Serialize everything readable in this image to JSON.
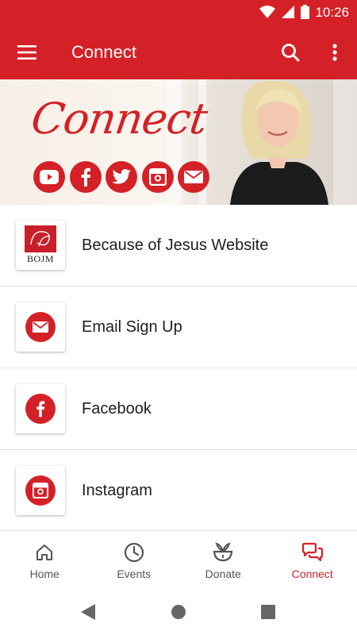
{
  "status_bar": {
    "time": "10:26"
  },
  "app_bar": {
    "title": "Connect"
  },
  "banner": {
    "heading": "Connect"
  },
  "list_items": [
    {
      "label": "Because of Jesus Website",
      "icon": "bojm-logo",
      "logo_text": "BOJM"
    },
    {
      "label": "Email Sign Up",
      "icon": "envelope-icon"
    },
    {
      "label": "Facebook",
      "icon": "facebook-icon"
    },
    {
      "label": "Instagram",
      "icon": "instagram-icon"
    }
  ],
  "bottom_nav": [
    {
      "label": "Home",
      "icon": "home-icon",
      "active": false
    },
    {
      "label": "Events",
      "icon": "clock-icon",
      "active": false
    },
    {
      "label": "Donate",
      "icon": "donate-icon",
      "active": false
    },
    {
      "label": "Connect",
      "icon": "chat-icon",
      "active": true
    }
  ],
  "colors": {
    "primary": "#d42127",
    "active_nav": "#d42127",
    "inactive_nav": "#555555"
  }
}
